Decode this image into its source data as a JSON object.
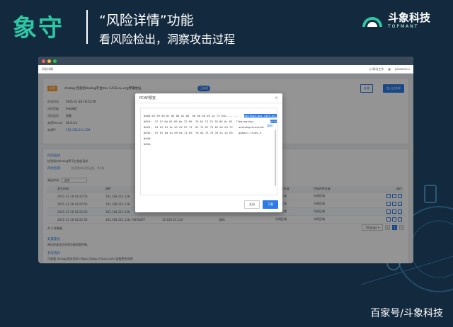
{
  "slide": {
    "title": "象守",
    "headline": "“风险详情”功能",
    "subhead": "看风险检出，洞察攻击过程",
    "brand_name": "斗象科技",
    "brand_sub": "TOPMANT",
    "watermark": "百家号/斗象科技"
  },
  "window": {
    "page_title": "风险详情",
    "topbar_items": [
      "◎ 联动工作",
      "▦",
      "prosesse ▾"
    ]
  },
  "risk": {
    "tag": "风险",
    "title": "dnslog 检测到dnslog平台dns 1433.eu.org传输地址",
    "status": "已处理",
    "btn_process": "处理",
    "btn_whitelist": "加入白名单",
    "fields": [
      {
        "k": "首发时间",
        "v": "2021-11-18 18:22:56"
      },
      {
        "k": "风险等级",
        "v": "Info风险"
      },
      {
        "k": "风险类型",
        "v": "恶意"
      },
      {
        "k": "来源Sensor",
        "v": "10.0.3.1"
      },
      {
        "k": "来源IP",
        "v": "192.168.214.128"
      }
    ]
  },
  "detail": {
    "section_title": "风险描述",
    "desc": "检测到对dnslog等平台发起请求",
    "evidence_title": "风险检测",
    "evidence_desc": "检测到的风险证据，共4条",
    "filter_label": "筛选时间:",
    "filter_value": "全部",
    "columns": [
      "发生时间",
      "源IP",
      "目标IP",
      "目标端口",
      "源IP所在域",
      "目标IP所在域",
      "操作"
    ],
    "rows": [
      [
        "2021-11-18 18:22:56",
        "192.168.214.128",
        "",
        "",
        "内网区域",
        "内网区域"
      ],
      [
        "2021-11-18 18:22:56",
        "192.168.214.128",
        "",
        "",
        "内网区域",
        "内网区域"
      ],
      [
        "2021-11-18 18:22:56",
        "192.168.214.128",
        "",
        "",
        "内网区域",
        "内网区域"
      ],
      [
        "2021-11-18 18:22:56",
        "192.168.214.128 / 9493297",
        "10.100.53.134",
        "DNS",
        "内网区域",
        "内网区域"
      ]
    ],
    "total": "共 4 条数据",
    "page_size": "10/page ▾",
    "pages": [
      "<",
      "1",
      ">"
    ],
    "foot_title": "处置建议",
    "foot_desc": "建议排查该主机是否被恶意控制。",
    "ref_title": "参考资料",
    "ref_desc": "可查看 dnslog 相关资料 (https://blog.chinaz.com) 查看更多资源"
  },
  "modal": {
    "title": "PCAP预览",
    "close": "×",
    "copy": "复制",
    "lines": [
      {
        "off": "0000:",
        "bytes": "55 99 60 01 05 00 01 00  00 00 00 00 1a 73 63",
        "ascii": "U........ ",
        "sel": "a6176a4.dns.1433.eu."
      },
      {
        "off": "0010:",
        "bytes": "37 37 6d 61 69 6e 72 69  76 64 73 79 78 66 6c 63",
        "ascii": "77maingtdsy",
        "sel": "xflc"
      },
      {
        "off": "0020:",
        "bytes": "61 6f 61 6c 61 62 67 72  61 74 6f 73 65 6e 64 72",
        "ascii": "aoalabgratosendr",
        "sel": ""
      },
      {
        "off": "0030:",
        "bytes": "67 6f 6d 61 69 6e 72 69  76 64 73 79 78 6c 2e 65",
        "ascii": "gomain.rivds.e.",
        "sel": ""
      },
      {
        "off": "0040:",
        "bytes": "",
        "ascii": "",
        "sel": ""
      },
      {
        "off": "0050:",
        "bytes": "",
        "ascii": "",
        "sel": ""
      }
    ],
    "btn_cancel": "关闭",
    "btn_download": "下载"
  }
}
